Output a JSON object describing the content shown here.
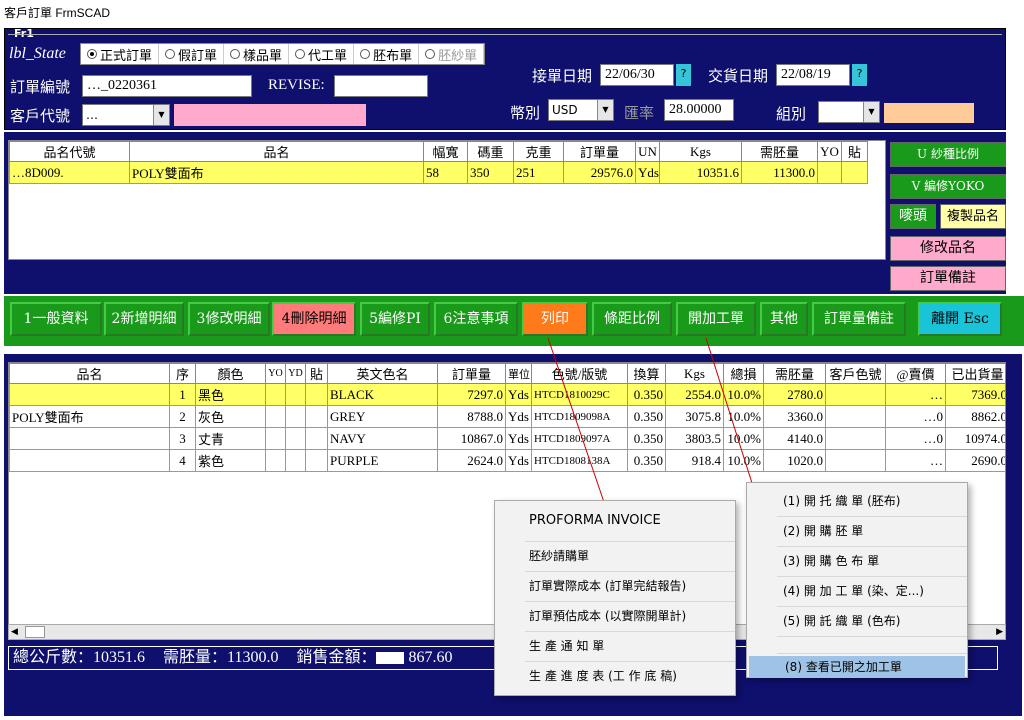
{
  "window_title": "客戶訂單 FrmSCAD",
  "frame_label": "Fr1",
  "state_label": "lbl_State",
  "order_types": [
    {
      "label": "正式訂單",
      "checked": true
    },
    {
      "label": "假訂單"
    },
    {
      "label": "樣品單"
    },
    {
      "label": "代工單"
    },
    {
      "label": "胚布單"
    },
    {
      "label": "胚紗單",
      "disabled": true
    }
  ],
  "labels": {
    "order_no": "訂單編號",
    "revise": "REVISE:",
    "customer": "客戶代號",
    "order_date": "接單日期",
    "delivery_date": "交貨日期",
    "currency": "幣別",
    "rate": "匯率",
    "group": "組別"
  },
  "values": {
    "order_no": "…_0220361",
    "revise": "",
    "customer": "…",
    "order_date": "22/06/30",
    "delivery_date": "22/08/19",
    "currency": "USD",
    "rate": "28.00000",
    "group": ""
  },
  "upper_table": {
    "headers": [
      "品名代號",
      "品名",
      "幅寬",
      "碼重",
      "克重",
      "訂單量",
      "UN",
      "Kgs",
      "需胚量",
      "YO",
      "貼"
    ],
    "row": [
      "…8D009.",
      "POLY雙面布",
      "58",
      "350",
      "251",
      "29576.0",
      "Yds",
      "10351.6",
      "11300.0",
      "",
      ""
    ]
  },
  "side_buttons": [
    "U 紗種比例",
    "V 編修YOKO",
    "嘜頭",
    "複製品名",
    "修改品名",
    "訂單備註"
  ],
  "toolbar": [
    "1一般資料",
    "2新增明細",
    "3修改明細",
    "4刪除明細",
    "5編修PI",
    "6注意事項",
    "列印",
    "條距比例",
    "開加工單",
    "其他",
    "訂單量備註",
    "離開 Esc"
  ],
  "lower_table": {
    "headers": [
      "品名",
      "序",
      "顏色",
      "YO",
      "YD",
      "貼",
      "英文色名",
      "訂單量",
      "單位",
      "色號/版號",
      "換算",
      "Kgs",
      "總損",
      "需胚量",
      "客戶色號",
      "@賣價",
      "已出貨量"
    ],
    "product": "POLY雙面布",
    "rows": [
      [
        "1",
        "黑色",
        "",
        "",
        "",
        "BLACK",
        "7297.0",
        "Yds",
        "HTCD1810029C",
        "0.350",
        "2554.0",
        "10.0%",
        "2780.0",
        "",
        "…",
        "7369.0"
      ],
      [
        "2",
        "灰色",
        "",
        "",
        "",
        "GREY",
        "8788.0",
        "Yds",
        "HTCD1809098A",
        "0.350",
        "3075.8",
        "10.0%",
        "3360.0",
        "",
        "…0",
        "8862.0"
      ],
      [
        "3",
        "丈青",
        "",
        "",
        "",
        "NAVY",
        "10867.0",
        "Yds",
        "HTCD1809097A",
        "0.350",
        "3803.5",
        "10.0%",
        "4140.0",
        "",
        "…0",
        "10974.0"
      ],
      [
        "4",
        "紫色",
        "",
        "",
        "",
        "PURPLE",
        "2624.0",
        "Yds",
        "HTCD1808138A",
        "0.350",
        "918.4",
        "10.0%",
        "1020.0",
        "",
        "…",
        "2690.0"
      ]
    ]
  },
  "summary": {
    "kg_label": "總公斤數：",
    "kg": "10351.6",
    "greige_label": "需胚量：",
    "greige": "11300.0",
    "sales_label": "銷售金額：",
    "sales": "867.60"
  },
  "print_menu": [
    "PROFORMA INVOICE",
    "胚紗請購單",
    "訂單實際成本 (訂單完結報告)",
    "訂單預估成本 (以實際開單計)",
    "生 產 通 知 單",
    "生 產 進 度 表 (工 作 底 稿)"
  ],
  "work_menu": [
    "(1) 開 托 織 單 (胚布)",
    "(2) 開 購 胚 單",
    "(3) 開 購 色 布 單",
    "(4) 開 加 工 單 (染、定...)",
    "(5) 開 託 織 單 (色布)",
    "",
    "(8) 查看已開之加工單"
  ],
  "colors": {
    "navy": "#0f0f6e",
    "green": "#1a9a1a",
    "yellow": "#ffff66",
    "pink": "#ffaacc"
  }
}
